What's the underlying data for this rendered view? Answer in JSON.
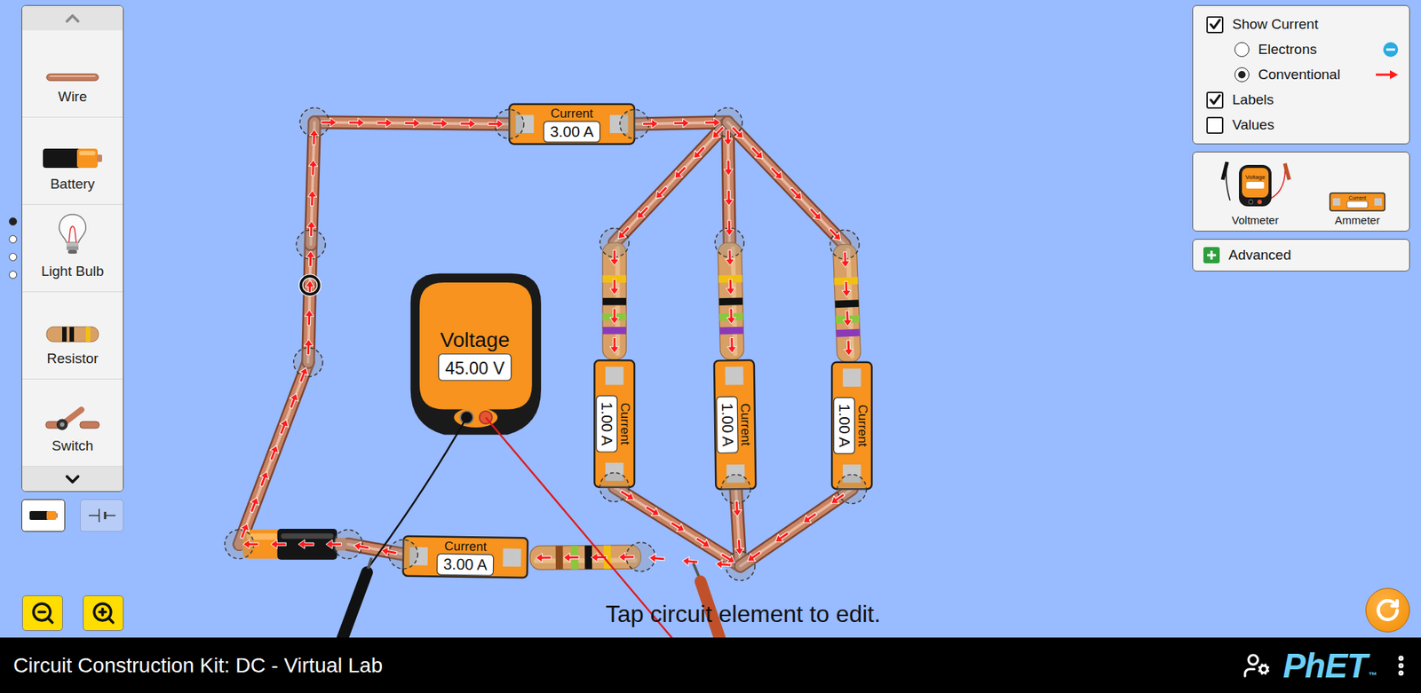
{
  "toolbox": {
    "scroll_up_disabled": true,
    "scroll_down_disabled": false,
    "items": [
      {
        "label": "Wire",
        "kind": "wire"
      },
      {
        "label": "Battery",
        "kind": "battery"
      },
      {
        "label": "Light Bulb",
        "kind": "bulb"
      },
      {
        "label": "Resistor",
        "kind": "resistor"
      },
      {
        "label": "Switch",
        "kind": "switch"
      }
    ]
  },
  "view_toggle": [
    {
      "kind": "lifelike",
      "selected": true
    },
    {
      "kind": "schematic",
      "selected": false
    }
  ],
  "page_dots": [
    {
      "selected": true
    },
    {
      "selected": false
    },
    {
      "selected": false
    },
    {
      "selected": false
    }
  ],
  "display": {
    "show_current": {
      "label": "Show Current",
      "checked": true
    },
    "current_type": [
      {
        "label": "Electrons",
        "kind": "electrons",
        "selected": false
      },
      {
        "label": "Conventional",
        "kind": "conventional",
        "selected": true
      }
    ],
    "labels": {
      "label": "Labels",
      "checked": true
    },
    "values": {
      "label": "Values",
      "checked": false
    }
  },
  "sensors": [
    {
      "label": "Voltmeter",
      "kind": "voltmeter",
      "icon_text": "Voltage"
    },
    {
      "label": "Ammeter",
      "kind": "ammeter",
      "icon_text": "Current"
    }
  ],
  "advanced": {
    "label": "Advanced",
    "expanded": false
  },
  "circuit": {
    "ammeters": [
      {
        "label": "Current",
        "reading": "3.00 A"
      },
      {
        "label": "Current",
        "reading": "1.00 A"
      },
      {
        "label": "Current",
        "reading": "1.00 A"
      },
      {
        "label": "Current",
        "reading": "1.00 A"
      },
      {
        "label": "Current",
        "reading": "3.00 A"
      }
    ],
    "voltmeter": {
      "label": "Voltage",
      "reading": "45.00 V"
    }
  },
  "hint": "Tap circuit element to edit.",
  "status_bar": {
    "title": "Circuit Construction Kit: DC - Virtual Lab",
    "logo": "PhET",
    "logo_mark": "™"
  }
}
